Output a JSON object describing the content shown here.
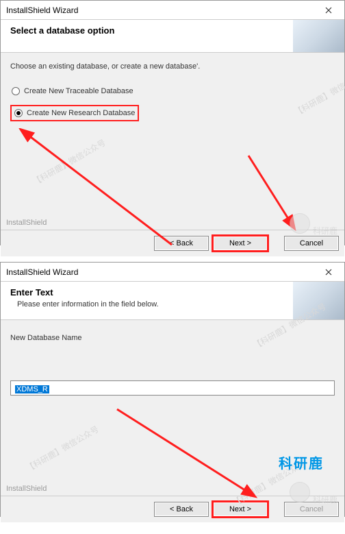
{
  "dialog1": {
    "title": "InstallShield Wizard",
    "heading": "Select a database option",
    "instruction": "Choose an existing database, or create a new database'.",
    "option1": "Create New Traceable Database",
    "option2": "Create New Research Database",
    "brand": "InstallShield",
    "back": "< Back",
    "next": "Next >",
    "cancel": "Cancel"
  },
  "dialog2": {
    "title": "InstallShield Wizard",
    "heading": "Enter Text",
    "sub": "Please enter information in the field below.",
    "label": "New Database Name",
    "value": "XDMS_R",
    "brand": "InstallShield",
    "back": "< Back",
    "next": "Next >",
    "cancel": "Cancel"
  },
  "watermark": {
    "text": "【科研鹿】微信公众号",
    "logo": "科研鹿"
  }
}
